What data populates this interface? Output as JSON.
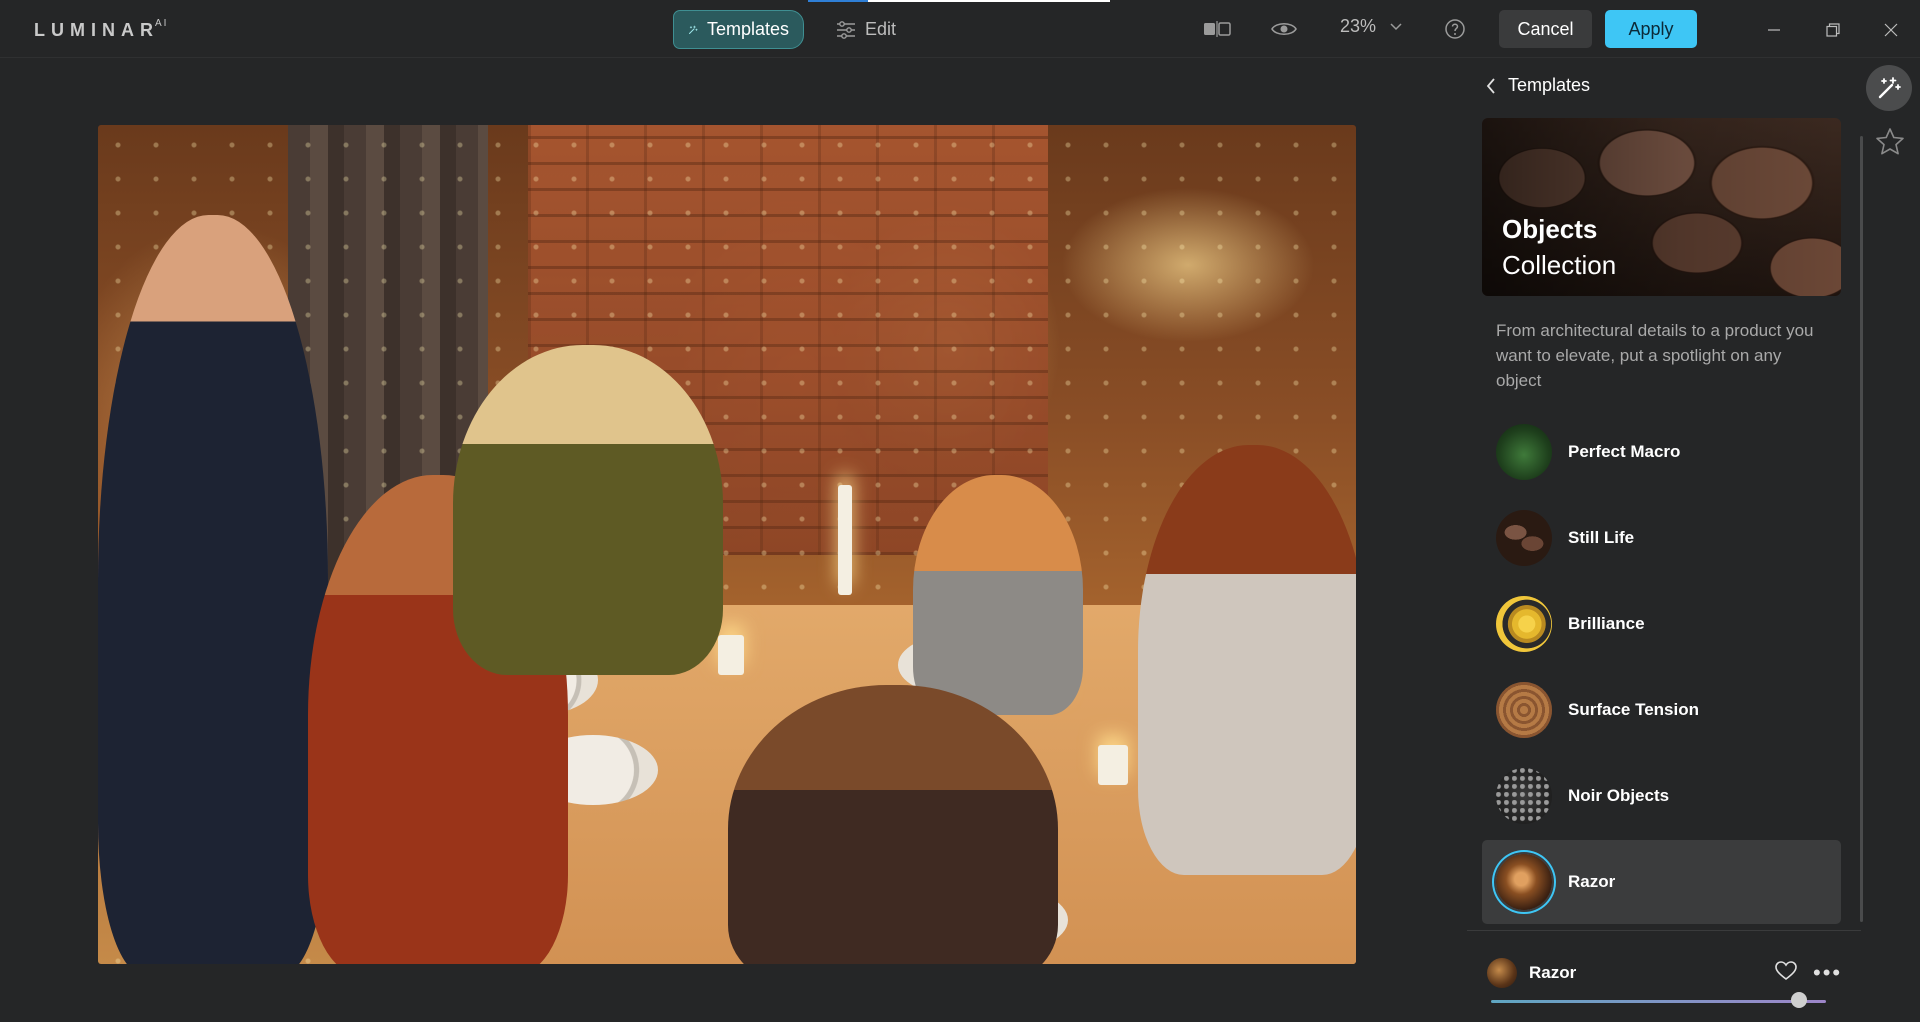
{
  "app": {
    "logo": "LUMINAR",
    "logo_sup": "AI"
  },
  "toolbar": {
    "templates_tab": "Templates",
    "edit_tab": "Edit",
    "zoom": "23%",
    "cancel_label": "Cancel",
    "apply_label": "Apply",
    "accent_color": "#3ec6f5"
  },
  "panel": {
    "back_title": "Templates",
    "collection_title_bold": "Objects",
    "collection_title": "Collection",
    "description": "From architectural details to a product you want to elevate, put a spotlight on any object",
    "templates": [
      {
        "label": "Perfect Macro",
        "icon": "leaf-thumbnail"
      },
      {
        "label": "Still Life",
        "icon": "coffee-beans-thumbnail"
      },
      {
        "label": "Brilliance",
        "icon": "snail-shell-thumbnail"
      },
      {
        "label": "Surface Tension",
        "icon": "wood-rings-thumbnail"
      },
      {
        "label": "Noir Objects",
        "icon": "dark-texture-thumbnail"
      },
      {
        "label": "Razor",
        "icon": "amber-thumbnail",
        "selected": true
      }
    ],
    "footer": {
      "selected_name": "Razor",
      "amount": 0.92
    }
  }
}
